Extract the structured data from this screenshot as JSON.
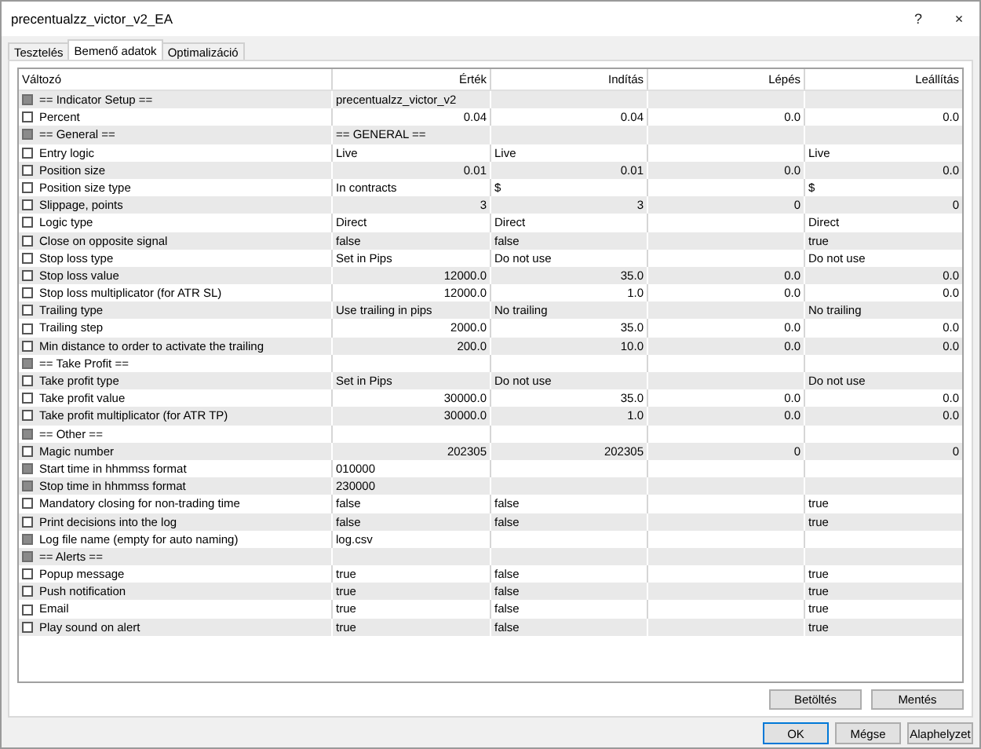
{
  "window": {
    "title": "precentualzz_victor_v2_EA",
    "help": "?",
    "close": "×"
  },
  "tabs": [
    {
      "label": "Tesztelés",
      "selected": false
    },
    {
      "label": "Bemenő adatok",
      "selected": true
    },
    {
      "label": "Optimalizáció",
      "selected": false
    }
  ],
  "table": {
    "columns": [
      "Változó",
      "Érték",
      "Indítás",
      "Lépés",
      "Leállítás"
    ],
    "rows": [
      {
        "kind": "group",
        "disabled": true,
        "name": "== Indicator Setup ==",
        "value": "precentualzz_victor_v2"
      },
      {
        "kind": "number",
        "disabled": false,
        "name": "Percent",
        "value": "0.04",
        "start": "0.04",
        "step": "0.0",
        "stop": "0.0"
      },
      {
        "kind": "group",
        "disabled": true,
        "name": "== General ==",
        "value": "== GENERAL =="
      },
      {
        "kind": "text",
        "disabled": false,
        "name": "Entry logic",
        "value": "Live",
        "start": "Live",
        "stop": "Live"
      },
      {
        "kind": "number",
        "disabled": false,
        "name": "Position size",
        "value": "0.01",
        "start": "0.01",
        "step": "0.0",
        "stop": "0.0"
      },
      {
        "kind": "text",
        "disabled": false,
        "name": "Position size type",
        "value": "In contracts",
        "start": "$",
        "stop": "$"
      },
      {
        "kind": "number",
        "disabled": false,
        "name": "Slippage, points",
        "value": "3",
        "start": "3",
        "step": "0",
        "stop": "0"
      },
      {
        "kind": "text",
        "disabled": false,
        "name": "Logic type",
        "value": "Direct",
        "start": "Direct",
        "stop": "Direct"
      },
      {
        "kind": "text",
        "disabled": false,
        "name": "Close on opposite signal",
        "value": "false",
        "start": "false",
        "stop": "true"
      },
      {
        "kind": "text",
        "disabled": false,
        "name": "Stop loss type",
        "value": "Set in Pips",
        "start": "Do not use",
        "stop": "Do not use"
      },
      {
        "kind": "number",
        "disabled": false,
        "name": "Stop loss value",
        "value": "12000.0",
        "start": "35.0",
        "step": "0.0",
        "stop": "0.0"
      },
      {
        "kind": "number",
        "disabled": false,
        "name": "Stop loss multiplicator (for ATR SL)",
        "value": "12000.0",
        "start": "1.0",
        "step": "0.0",
        "stop": "0.0"
      },
      {
        "kind": "text",
        "disabled": false,
        "name": "Trailing type",
        "value": "Use trailing in pips",
        "start": "No trailing",
        "stop": "No trailing"
      },
      {
        "kind": "number",
        "disabled": false,
        "name": "Trailing step",
        "value": "2000.0",
        "start": "35.0",
        "step": "0.0",
        "stop": "0.0"
      },
      {
        "kind": "number",
        "disabled": false,
        "name": "Min distance to order to activate the trailing",
        "value": "200.0",
        "start": "10.0",
        "step": "0.0",
        "stop": "0.0"
      },
      {
        "kind": "group",
        "disabled": true,
        "name": "== Take Profit =="
      },
      {
        "kind": "text",
        "disabled": false,
        "name": "Take profit type",
        "value": "Set in Pips",
        "start": "Do not use",
        "stop": "Do not use"
      },
      {
        "kind": "number",
        "disabled": false,
        "name": "Take profit value",
        "value": "30000.0",
        "start": "35.0",
        "step": "0.0",
        "stop": "0.0"
      },
      {
        "kind": "number",
        "disabled": false,
        "name": "Take profit multiplicator (for ATR TP)",
        "value": "30000.0",
        "start": "1.0",
        "step": "0.0",
        "stop": "0.0"
      },
      {
        "kind": "group",
        "disabled": true,
        "name": "== Other =="
      },
      {
        "kind": "number",
        "disabled": false,
        "name": "Magic number",
        "value": "202305",
        "start": "202305",
        "step": "0",
        "stop": "0"
      },
      {
        "kind": "text",
        "disabled": true,
        "name": "Start time in hhmmss format",
        "value": "010000"
      },
      {
        "kind": "text",
        "disabled": true,
        "name": "Stop time in hhmmss format",
        "value": "230000"
      },
      {
        "kind": "text",
        "disabled": false,
        "name": "Mandatory closing for non-trading time",
        "value": "false",
        "start": "false",
        "stop": "true"
      },
      {
        "kind": "text",
        "disabled": false,
        "name": "Print decisions into the log",
        "value": "false",
        "start": "false",
        "stop": "true"
      },
      {
        "kind": "text",
        "disabled": true,
        "name": "Log file name (empty for auto naming)",
        "value": "log.csv"
      },
      {
        "kind": "group",
        "disabled": true,
        "name": "== Alerts =="
      },
      {
        "kind": "text",
        "disabled": false,
        "name": "Popup message",
        "value": "true",
        "start": "false",
        "stop": "true"
      },
      {
        "kind": "text",
        "disabled": false,
        "name": "Push notification",
        "value": "true",
        "start": "false",
        "stop": "true"
      },
      {
        "kind": "text",
        "disabled": false,
        "name": "Email",
        "value": "true",
        "start": "false",
        "stop": "true"
      },
      {
        "kind": "text",
        "disabled": false,
        "name": "Play sound on alert",
        "value": "true",
        "start": "false",
        "stop": "true"
      }
    ]
  },
  "panel_buttons": [
    "Betöltés",
    "Mentés"
  ],
  "dialog_buttons": [
    {
      "label": "OK",
      "focused": true
    },
    {
      "label": "Mégse",
      "focused": false
    },
    {
      "label": "Alaphelyzet",
      "focused": false
    }
  ]
}
